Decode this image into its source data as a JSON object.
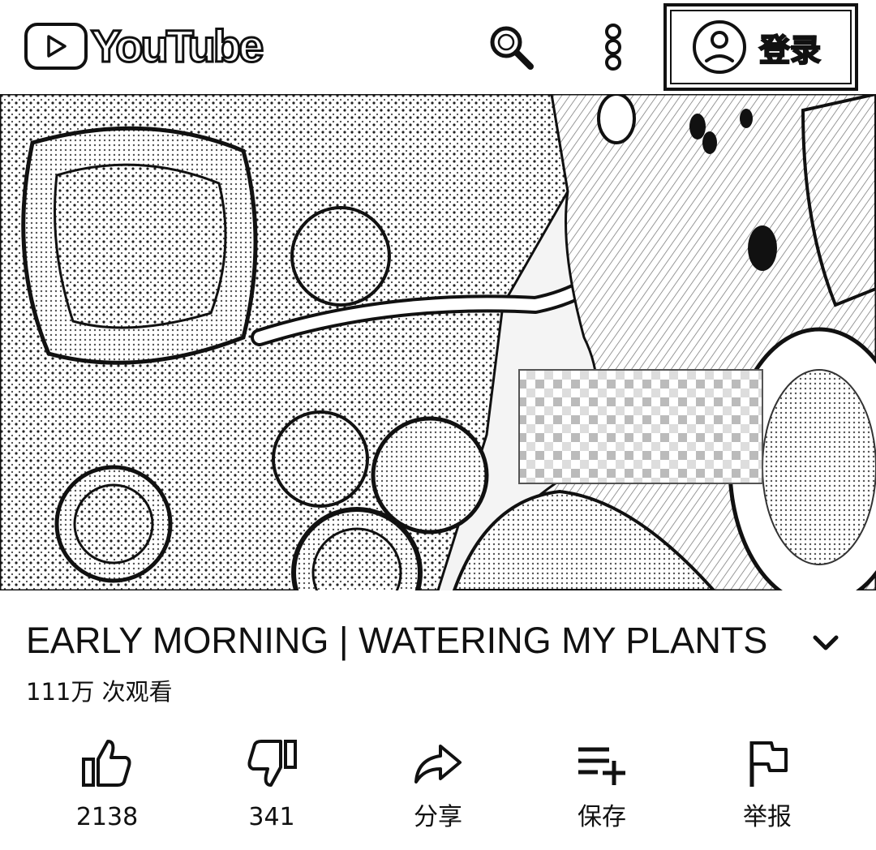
{
  "header": {
    "logo_text": "YouTube",
    "sign_in_label": "登录"
  },
  "icons": {
    "logo": "play-icon",
    "search": "search-icon",
    "more": "more-vertical-icon",
    "account": "account-circle-icon"
  },
  "video": {
    "title": "EARLY MORNING | WATERING MY PLANTS",
    "views": "111万 次观看"
  },
  "actions": [
    {
      "label": "2138",
      "icon": "thumb-up-icon"
    },
    {
      "label": "341",
      "icon": "thumb-down-icon"
    },
    {
      "label": "分享",
      "icon": "share-icon"
    },
    {
      "label": "保存",
      "icon": "playlist-add-icon"
    },
    {
      "label": "举报",
      "icon": "flag-icon"
    }
  ]
}
